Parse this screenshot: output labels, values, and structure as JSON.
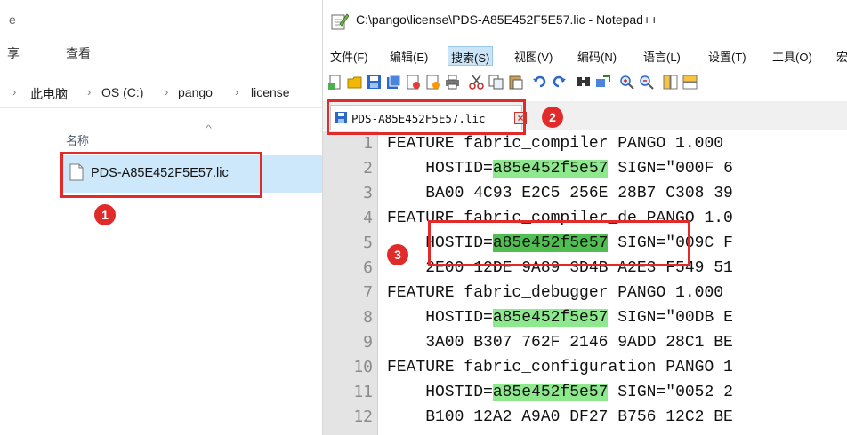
{
  "explorer": {
    "tabs": [
      {
        "label": "e"
      },
      {
        "label": "享"
      },
      {
        "label": "查看"
      }
    ],
    "breadcrumb": [
      {
        "label": "此电脑"
      },
      {
        "label": "OS (C:)"
      },
      {
        "label": "pango"
      },
      {
        "label": "license"
      }
    ],
    "column_header": "名称",
    "file": {
      "name": "PDS-A85E452F5E57.lic",
      "selected": true
    }
  },
  "npp": {
    "title": "C:\\pango\\license\\PDS-A85E452F5E57.lic - Notepad++",
    "menu": [
      {
        "label": "文件(F)"
      },
      {
        "label": "编辑(E)"
      },
      {
        "label": "搜索(S)",
        "active": true
      },
      {
        "label": "视图(V)"
      },
      {
        "label": "编码(N)"
      },
      {
        "label": "语言(L)"
      },
      {
        "label": "设置(T)"
      },
      {
        "label": "工具(O)"
      },
      {
        "label": "宏"
      }
    ],
    "toolbar_icons": [
      "new-file-icon",
      "open-file-icon",
      "save-icon",
      "save-all-icon",
      "close-icon",
      "close-all-icon",
      "print-icon",
      "cut-icon",
      "copy-icon",
      "paste-icon",
      "undo-icon",
      "redo-icon",
      "find-icon",
      "replace-icon",
      "zoom-in-icon",
      "zoom-out-icon",
      "sync-v-icon",
      "sync-h-icon"
    ],
    "tab": {
      "label": "PDS-A85E452F5E57.lic",
      "close": "×"
    },
    "lines": [
      {
        "n": "1",
        "pre": "FEATURE fabric_compiler PANGO 1.000 ",
        "hostid": "",
        "post": ""
      },
      {
        "n": "2",
        "pre": "    HOSTID=",
        "hostid": "a85e452f5e57",
        "post": " SIGN=\"000F 6"
      },
      {
        "n": "3",
        "pre": "    BA00 4C93 E2C5 256E 28B7 C308 39",
        "hostid": "",
        "post": ""
      },
      {
        "n": "4",
        "pre": "FEATURE fabric_compiler_de PANGO 1.0",
        "hostid": "",
        "post": ""
      },
      {
        "n": "5",
        "pre": "    HOSTID=",
        "hostid": "a85e452f5e57",
        "post": " SIGN=\"009C F",
        "selected": true
      },
      {
        "n": "6",
        "pre": "    2E00 12DE 9A89 3D4B A2E3 F549 51",
        "hostid": "",
        "post": ""
      },
      {
        "n": "7",
        "pre": "FEATURE fabric_debugger PANGO 1.000 ",
        "hostid": "",
        "post": ""
      },
      {
        "n": "8",
        "pre": "    HOSTID=",
        "hostid": "a85e452f5e57",
        "post": " SIGN=\"00DB E"
      },
      {
        "n": "9",
        "pre": "    3A00 B307 762F 2146 9ADD 28C1 BE",
        "hostid": "",
        "post": ""
      },
      {
        "n": "10",
        "pre": "FEATURE fabric_configuration PANGO 1",
        "hostid": "",
        "post": ""
      },
      {
        "n": "11",
        "pre": "    HOSTID=",
        "hostid": "a85e452f5e57",
        "post": " SIGN=\"0052 2"
      },
      {
        "n": "12",
        "pre": "    B100 12A2 A9A0 DF27 B756 12C2 BE",
        "hostid": "",
        "post": ""
      }
    ]
  },
  "annotations": {
    "badges": [
      "1",
      "2",
      "3"
    ],
    "color": "#e12b2b"
  },
  "colors": {
    "selection": "#cde8fa",
    "hostid_highlight": "#8ee88e",
    "hostid_selected": "#4fc04f",
    "gutter": "#e4e4e4"
  }
}
